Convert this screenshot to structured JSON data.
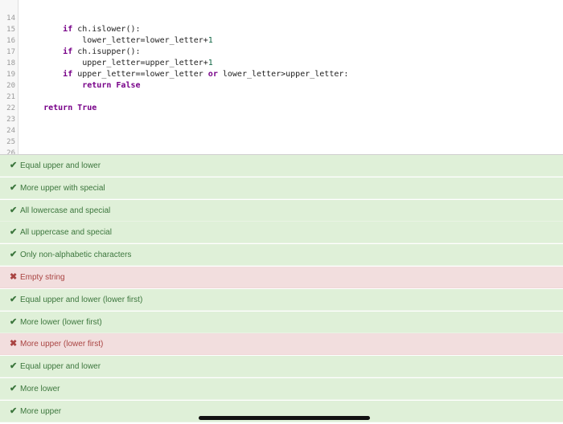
{
  "editor": {
    "lines": [
      {
        "num": "14",
        "code": "        if ch.islower():"
      },
      {
        "num": "15",
        "code": "            lower_letter=lower_letter+1"
      },
      {
        "num": "16",
        "code": "        if ch.isupper():"
      },
      {
        "num": "17",
        "code": "            upper_letter=upper_letter+1"
      },
      {
        "num": "18",
        "code": "        if upper_letter==lower_letter or lower_letter>upper_letter:"
      },
      {
        "num": "19",
        "code": "            return False"
      },
      {
        "num": "20",
        "code": ""
      },
      {
        "num": "21",
        "code": "    return True"
      },
      {
        "num": "22",
        "code": ""
      },
      {
        "num": "23",
        "code": ""
      },
      {
        "num": "24",
        "code": ""
      },
      {
        "num": "25",
        "code": ""
      },
      {
        "num": "26",
        "code": ""
      }
    ]
  },
  "tests": [
    {
      "status": "pass",
      "mark": "✔",
      "label": "Equal upper and lower"
    },
    {
      "status": "pass",
      "mark": "✔",
      "label": "More upper with special"
    },
    {
      "status": "pass",
      "mark": "✔",
      "label": "All lowercase and special"
    },
    {
      "status": "pass",
      "mark": "✔",
      "label": "All uppercase and special"
    },
    {
      "status": "pass",
      "mark": "✔",
      "label": "Only non-alphabetic characters"
    },
    {
      "status": "fail",
      "mark": "✖",
      "label": "Empty string"
    },
    {
      "status": "pass",
      "mark": "✔",
      "label": "Equal upper and lower (lower first)"
    },
    {
      "status": "pass",
      "mark": "✔",
      "label": "More lower (lower first)"
    },
    {
      "status": "fail",
      "mark": "✖",
      "label": "More upper (lower first)"
    },
    {
      "status": "pass",
      "mark": "✔",
      "label": "Equal upper and lower"
    },
    {
      "status": "pass",
      "mark": "✔",
      "label": "More lower"
    },
    {
      "status": "pass",
      "mark": "✔",
      "label": "More upper"
    }
  ],
  "colors": {
    "pass_bg": "#dff0d8",
    "pass_text": "#3c763d",
    "fail_bg": "#f2dede",
    "fail_text": "#a94442",
    "keyword": "#770088"
  }
}
